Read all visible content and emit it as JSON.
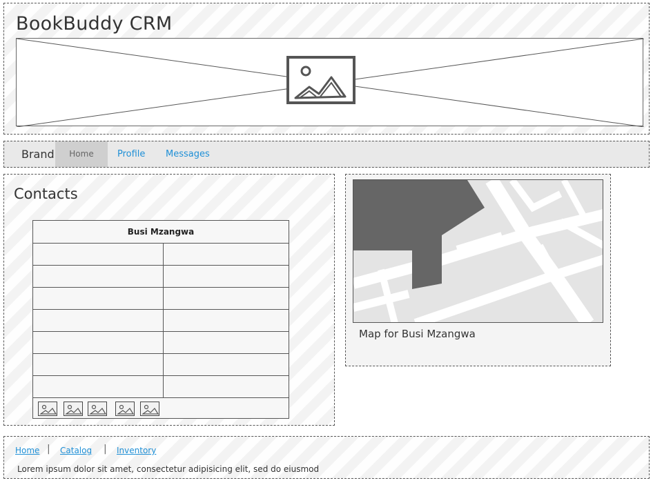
{
  "header": {
    "title": "BookBuddy CRM",
    "banner_icon": "image-placeholder-icon"
  },
  "navbar": {
    "brand": "Brand",
    "items": [
      {
        "label": "Home",
        "active": true
      },
      {
        "label": "Profile",
        "active": false
      },
      {
        "label": "Messages",
        "active": false
      }
    ]
  },
  "contacts": {
    "title": "Contacts",
    "table": {
      "header": "Busi Mzangwa",
      "rows": [
        [
          "",
          ""
        ],
        [
          "",
          ""
        ],
        [
          "",
          ""
        ],
        [
          "",
          ""
        ],
        [
          "",
          ""
        ],
        [
          "",
          ""
        ],
        [
          "",
          ""
        ]
      ],
      "footer_icons": [
        "image-icon",
        "image-icon",
        "image-icon",
        "image-icon",
        "image-icon"
      ]
    }
  },
  "map": {
    "caption": "Map for Busi Mzangwa"
  },
  "footer": {
    "links": [
      "Home",
      "Catalog",
      "Inventory"
    ],
    "text": "Lorem ipsum dolor sit amet, consectetur adipisicing elit, sed do eiusmod"
  },
  "colors": {
    "link": "#1e8fd6",
    "nav_active_bg": "#cfcfcf",
    "map_block": "#666666"
  }
}
